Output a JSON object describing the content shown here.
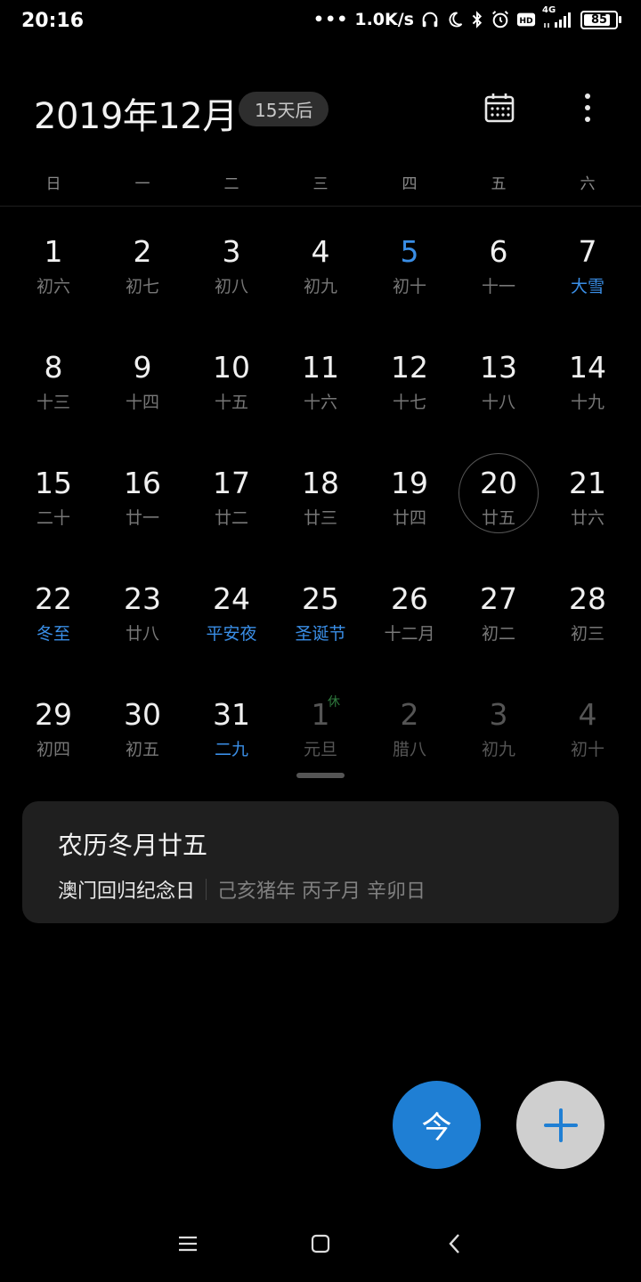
{
  "status": {
    "time": "20:16",
    "speed": "1.0K/s",
    "network": "4G",
    "battery": "85",
    "battery_level": 0.85,
    "icons": [
      "headphones-icon",
      "do-not-disturb-moon-icon",
      "bluetooth-icon",
      "alarm-icon",
      "hd-icon",
      "signal-icon",
      "battery-icon"
    ]
  },
  "header": {
    "month_title": "2019年12月",
    "days_badge": "15天后",
    "calendar_icon": "calendar-icon",
    "more_icon": "more-vertical-icon"
  },
  "weekdays": [
    "日",
    "一",
    "二",
    "三",
    "四",
    "五",
    "六"
  ],
  "days": [
    {
      "num": "1",
      "lunar": "初六"
    },
    {
      "num": "2",
      "lunar": "初七"
    },
    {
      "num": "3",
      "lunar": "初八"
    },
    {
      "num": "4",
      "lunar": "初九"
    },
    {
      "num": "5",
      "lunar": "初十",
      "today": true
    },
    {
      "num": "6",
      "lunar": "十一"
    },
    {
      "num": "7",
      "lunar": "大雪",
      "highlight": true
    },
    {
      "num": "8",
      "lunar": "十三"
    },
    {
      "num": "9",
      "lunar": "十四"
    },
    {
      "num": "10",
      "lunar": "十五"
    },
    {
      "num": "11",
      "lunar": "十六"
    },
    {
      "num": "12",
      "lunar": "十七"
    },
    {
      "num": "13",
      "lunar": "十八"
    },
    {
      "num": "14",
      "lunar": "十九"
    },
    {
      "num": "15",
      "lunar": "二十"
    },
    {
      "num": "16",
      "lunar": "廿一"
    },
    {
      "num": "17",
      "lunar": "廿二"
    },
    {
      "num": "18",
      "lunar": "廿三"
    },
    {
      "num": "19",
      "lunar": "廿四"
    },
    {
      "num": "20",
      "lunar": "廿五",
      "selected": true
    },
    {
      "num": "21",
      "lunar": "廿六"
    },
    {
      "num": "22",
      "lunar": "冬至",
      "highlight": true
    },
    {
      "num": "23",
      "lunar": "廿八"
    },
    {
      "num": "24",
      "lunar": "平安夜",
      "highlight": true
    },
    {
      "num": "25",
      "lunar": "圣诞节",
      "highlight": true
    },
    {
      "num": "26",
      "lunar": "十二月"
    },
    {
      "num": "27",
      "lunar": "初二"
    },
    {
      "num": "28",
      "lunar": "初三"
    },
    {
      "num": "29",
      "lunar": "初四"
    },
    {
      "num": "30",
      "lunar": "初五"
    },
    {
      "num": "31",
      "lunar": "二九",
      "highlight": true
    },
    {
      "num": "1",
      "lunar": "元旦",
      "other": true,
      "tag": "休"
    },
    {
      "num": "2",
      "lunar": "腊八",
      "other": true
    },
    {
      "num": "3",
      "lunar": "初九",
      "other": true
    },
    {
      "num": "4",
      "lunar": "初十",
      "other": true
    }
  ],
  "info_card": {
    "title": "农历冬月廿五",
    "festival": "澳门回归纪念日",
    "ganzhi": "己亥猪年 丙子月 辛卯日"
  },
  "fab": {
    "today_label": "今",
    "add_icon": "plus-icon"
  },
  "colors": {
    "accent": "#1f7fd4",
    "highlight_text": "#3a8ee6",
    "background": "#000000",
    "card": "#1f1f1f",
    "holiday_tag": "#2f7a3e"
  },
  "nav": {
    "menu_icon": "menu-icon",
    "home_icon": "home-square-icon",
    "back_icon": "back-chevron-icon"
  }
}
